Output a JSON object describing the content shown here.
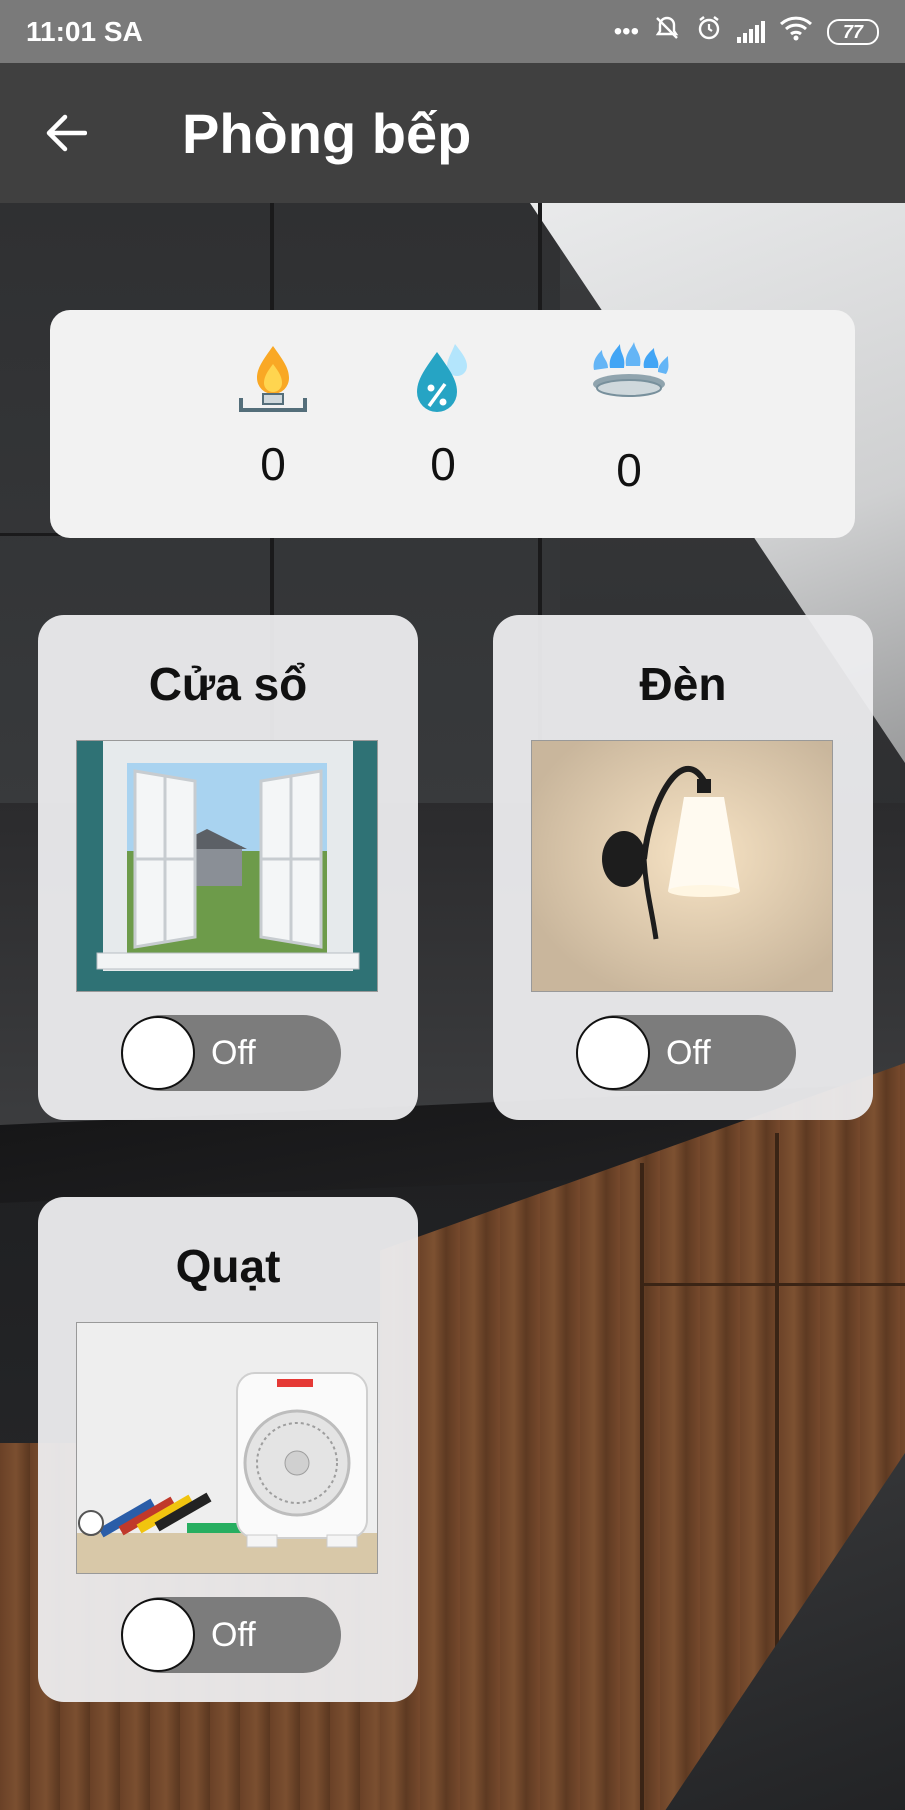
{
  "status_bar": {
    "time": "11:01 SA",
    "battery": "77",
    "more": "•••"
  },
  "app_bar": {
    "title": "Phòng bếp"
  },
  "sensors": [
    {
      "icon": "gas-icon",
      "value": "0"
    },
    {
      "icon": "humidity-icon",
      "value": "0"
    },
    {
      "icon": "stove-flame-icon",
      "value": "0"
    }
  ],
  "devices": [
    {
      "name": "Cửa sổ",
      "state": "Off",
      "image": "window-photo"
    },
    {
      "name": "Đèn",
      "state": "Off",
      "image": "lamp-photo"
    },
    {
      "name": "Quạt",
      "state": "Off",
      "image": "fan-photo"
    }
  ],
  "colors": {
    "app_bar": "#404040",
    "status_bar": "#7a7a7a",
    "toggle_off": "#7c7c7c"
  }
}
